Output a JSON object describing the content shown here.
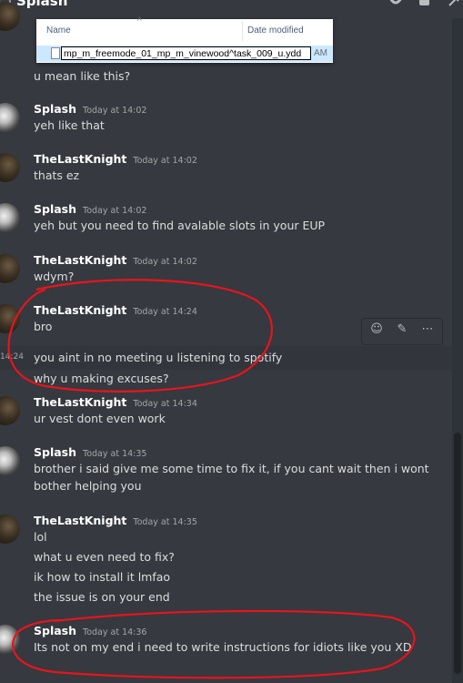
{
  "channel": {
    "title": "Splash"
  },
  "explorer": {
    "col_name": "Name",
    "col_date": "Date modified",
    "rename_value": "mp_m_freemode_01_mp_m_vinewood^task_009_u.ydd",
    "date_partial": "AM"
  },
  "messages": [
    {
      "id": "m0",
      "author": null,
      "lines": [
        "u mean like this?"
      ]
    },
    {
      "id": "m1",
      "author": "Splash",
      "avatar": "splash-avatar",
      "timestamp": "Today at 14:02",
      "lines": [
        "yeh like that"
      ]
    },
    {
      "id": "m2",
      "author": "TheLastKnight",
      "avatar": "thelastknight-avatar",
      "timestamp": "Today at 14:02",
      "lines": [
        "thats ez"
      ]
    },
    {
      "id": "m3",
      "author": "Splash",
      "avatar": "splash-avatar",
      "timestamp": "Today at 14:02",
      "lines": [
        "yeh but you need to find avalable slots in your EUP"
      ]
    },
    {
      "id": "m4",
      "author": "TheLastKnight",
      "avatar": "thelastknight-avatar",
      "timestamp": "Today at 14:02",
      "lines": [
        "wdym?"
      ]
    },
    {
      "id": "m5",
      "author": "TheLastKnight",
      "avatar": "thelastknight-avatar",
      "timestamp": "Today at 14:24",
      "lines": [
        "bro",
        "you aint in no meeting u listening to spotify",
        "why u making excuses?"
      ],
      "hover_time": "14:24"
    },
    {
      "id": "m6",
      "author": "TheLastKnight",
      "avatar": "thelastknight-avatar",
      "timestamp": "Today at 14:34",
      "lines": [
        "ur vest dont even work"
      ]
    },
    {
      "id": "m7",
      "author": "Splash",
      "avatar": "splash-avatar",
      "timestamp": "Today at 14:35",
      "lines": [
        "brother i said give me some time to fix it, if you cant wait then i wont",
        "bother helping you"
      ]
    },
    {
      "id": "m8",
      "author": "TheLastKnight",
      "avatar": "thelastknight-avatar",
      "timestamp": "Today at 14:35",
      "lines": [
        "lol",
        "what u even need to fix?",
        "ik how to install it lmfao",
        "the issue is on your end"
      ]
    },
    {
      "id": "m9",
      "author": "Splash",
      "avatar": "splash-avatar",
      "timestamp": "Today at 14:36",
      "lines": [
        "Its not on my end i need to write instructions for idiots like you XD"
      ]
    }
  ],
  "toolbar": {
    "icons": [
      "add-reaction-icon",
      "edit-icon",
      "more-icon"
    ]
  },
  "colors": {
    "background": "#36393f",
    "hover": "#32353b",
    "annotation": "#e8141c"
  }
}
